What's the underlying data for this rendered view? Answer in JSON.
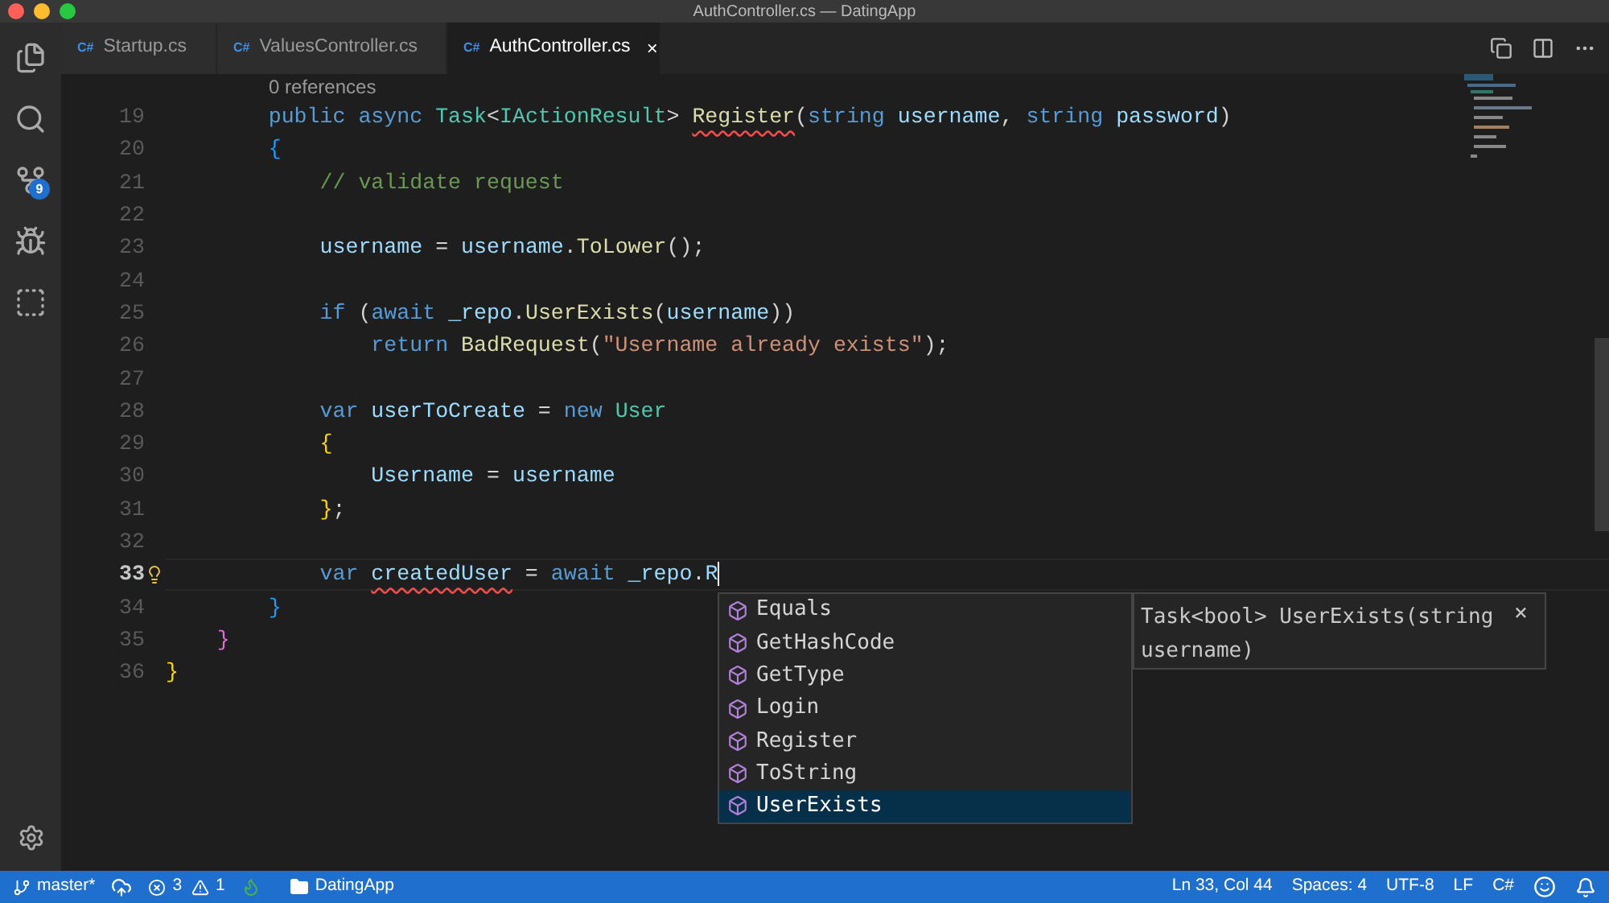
{
  "window": {
    "title": "AuthController.cs — DatingApp"
  },
  "activity_bar": {
    "source_control_badge": "9"
  },
  "tabs": [
    {
      "lang": "C#",
      "label": "Startup.cs",
      "selected": false
    },
    {
      "lang": "C#",
      "label": "ValuesController.cs",
      "selected": false
    },
    {
      "lang": "C#",
      "label": "AuthController.cs",
      "selected": true,
      "close": "×"
    }
  ],
  "codelens": "0 references",
  "lines": [
    {
      "number": "19",
      "current": false,
      "tokens": [
        {
          "kind": "kw",
          "text": "        public async "
        },
        {
          "kind": "type",
          "text": "Task"
        },
        {
          "kind": "punc",
          "text": "<"
        },
        {
          "kind": "type",
          "text": "IActionResult"
        },
        {
          "kind": "punc",
          "text": "> "
        },
        {
          "kind": "fn_err",
          "text": "Register"
        },
        {
          "kind": "punc",
          "text": "("
        },
        {
          "kind": "kw",
          "text": "string"
        },
        {
          "kind": "var",
          "text": " username"
        },
        {
          "kind": "punc",
          "text": ", "
        },
        {
          "kind": "kw",
          "text": "string"
        },
        {
          "kind": "var",
          "text": " password"
        },
        {
          "kind": "punc",
          "text": ")"
        }
      ]
    },
    {
      "number": "20",
      "current": false,
      "tokens": [
        {
          "kind": "brace3",
          "text": "        {"
        }
      ]
    },
    {
      "number": "21",
      "current": false,
      "tokens": [
        {
          "kind": "comment",
          "text": "            // validate request"
        }
      ]
    },
    {
      "number": "22",
      "current": false
    },
    {
      "number": "23",
      "current": false,
      "tokens": [
        {
          "kind": "var",
          "text": "            username"
        },
        {
          "kind": "punc",
          "text": " = "
        },
        {
          "kind": "var",
          "text": "username"
        },
        {
          "kind": "punc",
          "text": "."
        },
        {
          "kind": "fn",
          "text": "ToLower"
        },
        {
          "kind": "punc",
          "text": "();"
        }
      ]
    },
    {
      "number": "24",
      "current": false
    },
    {
      "number": "25",
      "current": false,
      "tokens": [
        {
          "kind": "kw",
          "text": "            if"
        },
        {
          "kind": "punc",
          "text": " ("
        },
        {
          "kind": "kw",
          "text": "await"
        },
        {
          "kind": "var",
          "text": " _repo"
        },
        {
          "kind": "punc",
          "text": "."
        },
        {
          "kind": "fn",
          "text": "UserExists"
        },
        {
          "kind": "punc",
          "text": "("
        },
        {
          "kind": "var",
          "text": "username"
        },
        {
          "kind": "punc",
          "text": "))"
        }
      ]
    },
    {
      "number": "26",
      "current": false,
      "tokens": [
        {
          "kind": "kw",
          "text": "                return "
        },
        {
          "kind": "fn",
          "text": "BadRequest"
        },
        {
          "kind": "punc",
          "text": "("
        },
        {
          "kind": "str",
          "text": "\"Username already exists\""
        },
        {
          "kind": "punc",
          "text": ");"
        }
      ]
    },
    {
      "number": "27",
      "current": false
    },
    {
      "number": "28",
      "current": false,
      "tokens": [
        {
          "kind": "kw",
          "text": "            var"
        },
        {
          "kind": "var",
          "text": " userToCreate"
        },
        {
          "kind": "punc",
          "text": " = "
        },
        {
          "kind": "kw",
          "text": "new "
        },
        {
          "kind": "type",
          "text": "User"
        }
      ]
    },
    {
      "number": "29",
      "current": false,
      "tokens": [
        {
          "kind": "brace4",
          "text": "            {"
        }
      ]
    },
    {
      "number": "30",
      "current": false,
      "tokens": [
        {
          "kind": "var",
          "text": "                Username"
        },
        {
          "kind": "punc",
          "text": " = "
        },
        {
          "kind": "var",
          "text": "username"
        }
      ]
    },
    {
      "number": "31",
      "current": false,
      "tokens": [
        {
          "kind": "brace4",
          "text": "            }"
        },
        {
          "kind": "punc",
          "text": ";"
        }
      ]
    },
    {
      "number": "32",
      "current": false
    },
    {
      "number": "33",
      "current": true,
      "tokens": [
        {
          "kind": "kw",
          "text": "            var "
        },
        {
          "kind": "var_err",
          "text": "createdUser"
        },
        {
          "kind": "punc",
          "text": " = "
        },
        {
          "kind": "kw",
          "text": "await"
        },
        {
          "kind": "var",
          "text": " _repo"
        },
        {
          "kind": "punc",
          "text": "."
        },
        {
          "kind": "var",
          "text": "R"
        }
      ]
    },
    {
      "number": "34",
      "current": false,
      "tokens": [
        {
          "kind": "brace3",
          "text": "        }"
        }
      ]
    },
    {
      "number": "35",
      "current": false,
      "tokens": [
        {
          "kind": "brace2",
          "text": "    }"
        }
      ]
    },
    {
      "number": "36",
      "current": false,
      "tokens": [
        {
          "kind": "brace1",
          "text": "}"
        }
      ]
    }
  ],
  "suggestions": [
    {
      "label": "Equals",
      "selected": false
    },
    {
      "label": "GetHashCode",
      "selected": false
    },
    {
      "label": "GetType",
      "selected": false
    },
    {
      "label": "Login",
      "selected": false
    },
    {
      "label": "Register",
      "selected": false
    },
    {
      "label": "ToString",
      "selected": false
    },
    {
      "label": "UserExists",
      "selected": true
    }
  ],
  "suggestion_detail": {
    "text": "Task<bool> UserExists(string username)",
    "close": "×"
  },
  "status_bar": {
    "left": [
      {
        "kind": "branch",
        "text": "master*"
      },
      {
        "kind": "sync"
      },
      {
        "kind": "errors",
        "text": "3"
      },
      {
        "kind": "warnings",
        "text": "1"
      },
      {
        "kind": "flame"
      },
      {
        "kind": "folder",
        "text": "DatingApp"
      }
    ],
    "right": [
      {
        "kind": "text",
        "text": "Ln 33, Col 44"
      },
      {
        "kind": "text",
        "text": "Spaces: 4"
      },
      {
        "kind": "text",
        "text": "UTF-8"
      },
      {
        "kind": "text",
        "text": "LF"
      },
      {
        "kind": "text",
        "text": "C#"
      },
      {
        "kind": "smiley"
      },
      {
        "kind": "bell"
      }
    ]
  }
}
